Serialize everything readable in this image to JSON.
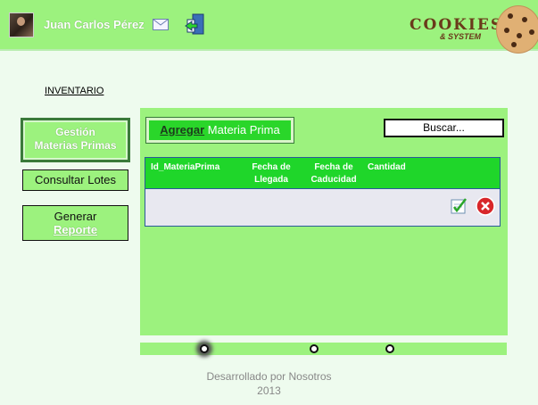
{
  "header": {
    "user_name": "Juan Carlos Pérez",
    "logo_text": "COOKIES",
    "logo_sub": "& SYSTEM",
    "colors": {
      "bar": "#9cf27e",
      "accent": "#2ad62a"
    }
  },
  "nav": {
    "section_title": "INVENTARIO",
    "gestion_line1": "Gestión",
    "gestion_line2": "Materias Primas",
    "consultar": "Consultar Lotes",
    "generar_line1": "Generar",
    "generar_line2": "Reporte"
  },
  "toolbar": {
    "agregar_prefix": "Agregar",
    "agregar_suffix": " Materia Prima",
    "search_label": "Buscar..."
  },
  "table": {
    "columns": [
      "Id_MateriaPrima",
      "Fecha de Llegada",
      "Fecha de Caducidad",
      "Cantidad"
    ],
    "rows": [
      {
        "cells": [
          "",
          "",
          "",
          ""
        ],
        "actions": [
          "edit-icon",
          "delete-icon"
        ]
      }
    ]
  },
  "footer": {
    "line1": "Desarrollado por Nosotros",
    "line2": "2013"
  }
}
